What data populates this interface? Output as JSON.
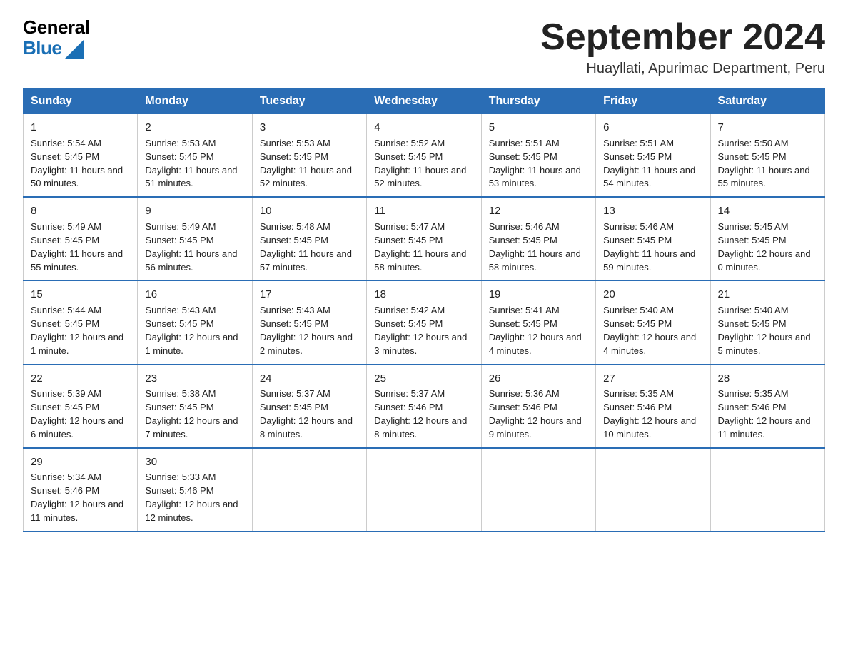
{
  "header": {
    "logo_general": "General",
    "logo_blue": "Blue",
    "main_title": "September 2024",
    "subtitle": "Huayllati, Apurimac Department, Peru"
  },
  "columns": [
    "Sunday",
    "Monday",
    "Tuesday",
    "Wednesday",
    "Thursday",
    "Friday",
    "Saturday"
  ],
  "weeks": [
    [
      {
        "day": "1",
        "sunrise": "Sunrise: 5:54 AM",
        "sunset": "Sunset: 5:45 PM",
        "daylight": "Daylight: 11 hours and 50 minutes."
      },
      {
        "day": "2",
        "sunrise": "Sunrise: 5:53 AM",
        "sunset": "Sunset: 5:45 PM",
        "daylight": "Daylight: 11 hours and 51 minutes."
      },
      {
        "day": "3",
        "sunrise": "Sunrise: 5:53 AM",
        "sunset": "Sunset: 5:45 PM",
        "daylight": "Daylight: 11 hours and 52 minutes."
      },
      {
        "day": "4",
        "sunrise": "Sunrise: 5:52 AM",
        "sunset": "Sunset: 5:45 PM",
        "daylight": "Daylight: 11 hours and 52 minutes."
      },
      {
        "day": "5",
        "sunrise": "Sunrise: 5:51 AM",
        "sunset": "Sunset: 5:45 PM",
        "daylight": "Daylight: 11 hours and 53 minutes."
      },
      {
        "day": "6",
        "sunrise": "Sunrise: 5:51 AM",
        "sunset": "Sunset: 5:45 PM",
        "daylight": "Daylight: 11 hours and 54 minutes."
      },
      {
        "day": "7",
        "sunrise": "Sunrise: 5:50 AM",
        "sunset": "Sunset: 5:45 PM",
        "daylight": "Daylight: 11 hours and 55 minutes."
      }
    ],
    [
      {
        "day": "8",
        "sunrise": "Sunrise: 5:49 AM",
        "sunset": "Sunset: 5:45 PM",
        "daylight": "Daylight: 11 hours and 55 minutes."
      },
      {
        "day": "9",
        "sunrise": "Sunrise: 5:49 AM",
        "sunset": "Sunset: 5:45 PM",
        "daylight": "Daylight: 11 hours and 56 minutes."
      },
      {
        "day": "10",
        "sunrise": "Sunrise: 5:48 AM",
        "sunset": "Sunset: 5:45 PM",
        "daylight": "Daylight: 11 hours and 57 minutes."
      },
      {
        "day": "11",
        "sunrise": "Sunrise: 5:47 AM",
        "sunset": "Sunset: 5:45 PM",
        "daylight": "Daylight: 11 hours and 58 minutes."
      },
      {
        "day": "12",
        "sunrise": "Sunrise: 5:46 AM",
        "sunset": "Sunset: 5:45 PM",
        "daylight": "Daylight: 11 hours and 58 minutes."
      },
      {
        "day": "13",
        "sunrise": "Sunrise: 5:46 AM",
        "sunset": "Sunset: 5:45 PM",
        "daylight": "Daylight: 11 hours and 59 minutes."
      },
      {
        "day": "14",
        "sunrise": "Sunrise: 5:45 AM",
        "sunset": "Sunset: 5:45 PM",
        "daylight": "Daylight: 12 hours and 0 minutes."
      }
    ],
    [
      {
        "day": "15",
        "sunrise": "Sunrise: 5:44 AM",
        "sunset": "Sunset: 5:45 PM",
        "daylight": "Daylight: 12 hours and 1 minute."
      },
      {
        "day": "16",
        "sunrise": "Sunrise: 5:43 AM",
        "sunset": "Sunset: 5:45 PM",
        "daylight": "Daylight: 12 hours and 1 minute."
      },
      {
        "day": "17",
        "sunrise": "Sunrise: 5:43 AM",
        "sunset": "Sunset: 5:45 PM",
        "daylight": "Daylight: 12 hours and 2 minutes."
      },
      {
        "day": "18",
        "sunrise": "Sunrise: 5:42 AM",
        "sunset": "Sunset: 5:45 PM",
        "daylight": "Daylight: 12 hours and 3 minutes."
      },
      {
        "day": "19",
        "sunrise": "Sunrise: 5:41 AM",
        "sunset": "Sunset: 5:45 PM",
        "daylight": "Daylight: 12 hours and 4 minutes."
      },
      {
        "day": "20",
        "sunrise": "Sunrise: 5:40 AM",
        "sunset": "Sunset: 5:45 PM",
        "daylight": "Daylight: 12 hours and 4 minutes."
      },
      {
        "day": "21",
        "sunrise": "Sunrise: 5:40 AM",
        "sunset": "Sunset: 5:45 PM",
        "daylight": "Daylight: 12 hours and 5 minutes."
      }
    ],
    [
      {
        "day": "22",
        "sunrise": "Sunrise: 5:39 AM",
        "sunset": "Sunset: 5:45 PM",
        "daylight": "Daylight: 12 hours and 6 minutes."
      },
      {
        "day": "23",
        "sunrise": "Sunrise: 5:38 AM",
        "sunset": "Sunset: 5:45 PM",
        "daylight": "Daylight: 12 hours and 7 minutes."
      },
      {
        "day": "24",
        "sunrise": "Sunrise: 5:37 AM",
        "sunset": "Sunset: 5:45 PM",
        "daylight": "Daylight: 12 hours and 8 minutes."
      },
      {
        "day": "25",
        "sunrise": "Sunrise: 5:37 AM",
        "sunset": "Sunset: 5:46 PM",
        "daylight": "Daylight: 12 hours and 8 minutes."
      },
      {
        "day": "26",
        "sunrise": "Sunrise: 5:36 AM",
        "sunset": "Sunset: 5:46 PM",
        "daylight": "Daylight: 12 hours and 9 minutes."
      },
      {
        "day": "27",
        "sunrise": "Sunrise: 5:35 AM",
        "sunset": "Sunset: 5:46 PM",
        "daylight": "Daylight: 12 hours and 10 minutes."
      },
      {
        "day": "28",
        "sunrise": "Sunrise: 5:35 AM",
        "sunset": "Sunset: 5:46 PM",
        "daylight": "Daylight: 12 hours and 11 minutes."
      }
    ],
    [
      {
        "day": "29",
        "sunrise": "Sunrise: 5:34 AM",
        "sunset": "Sunset: 5:46 PM",
        "daylight": "Daylight: 12 hours and 11 minutes."
      },
      {
        "day": "30",
        "sunrise": "Sunrise: 5:33 AM",
        "sunset": "Sunset: 5:46 PM",
        "daylight": "Daylight: 12 hours and 12 minutes."
      },
      null,
      null,
      null,
      null,
      null
    ]
  ]
}
